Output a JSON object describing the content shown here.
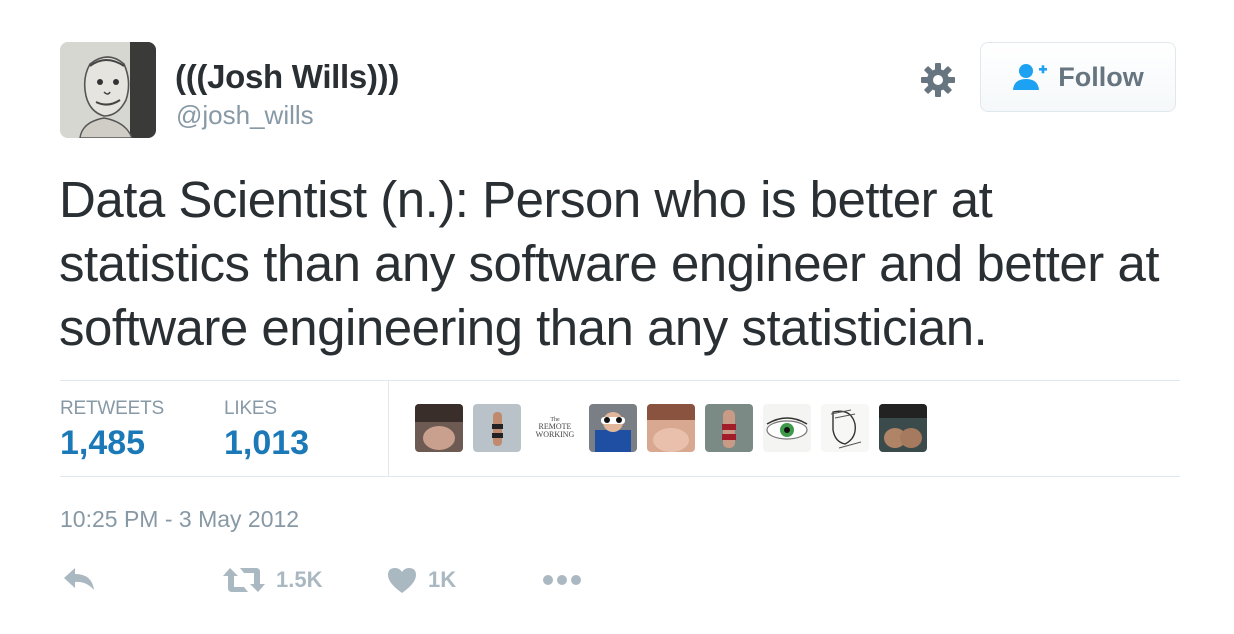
{
  "user": {
    "display_name": "(((Josh Wills)))",
    "handle": "@josh_wills",
    "avatar_icon": "caricature-avatar"
  },
  "header": {
    "gear_icon": "gear-icon",
    "follow_label": "Follow",
    "follow_icon": "add-user-icon"
  },
  "tweet": {
    "lines": [
      "Data Scientist (n.): Person who is better at",
      "statistics than any software engineer and better at",
      "software engineering than any statistician."
    ]
  },
  "stats": {
    "retweets_label": "RETWEETS",
    "retweets_value": "1,485",
    "likes_label": "LIKES",
    "likes_value": "1,013"
  },
  "likers": {
    "remote_small": "The",
    "remote_line1": "REMOTE",
    "remote_line2": "WORKING"
  },
  "timestamp": "10:25 PM - 3 May 2012",
  "actions": {
    "retweet_count": "1.5K",
    "like_count": "1K"
  },
  "colors": {
    "accent": "#1b79b7",
    "muted": "#8899a6",
    "icon": "#aab8c2",
    "text": "#292f33"
  }
}
